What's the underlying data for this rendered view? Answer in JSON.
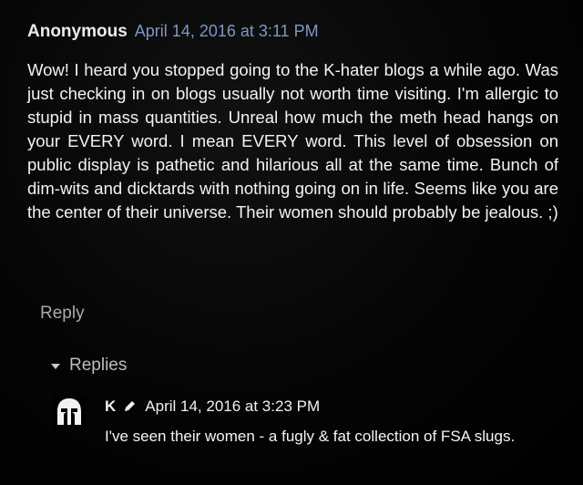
{
  "comment": {
    "author": "Anonymous",
    "timestamp": "April 14, 2016 at 3:11 PM",
    "text": "Wow! I heard you stopped going to the K-hater blogs a while ago. Was just checking in on blogs usually not worth time visiting. I'm allergic to stupid in mass quantities. Unreal how much the meth head hangs on your EVERY word. I mean EVERY word. This level of obsession on public display is pathetic and hilarious all at the same time. Bunch of dim-wits and dicktards with nothing going on in life. Seems like you are the center of their universe. Their women should probably be jealous. ;)",
    "reply_label": "Reply"
  },
  "replies": {
    "toggle_label": "Replies",
    "items": [
      {
        "author": "K",
        "timestamp": "April 14, 2016 at 3:23 PM",
        "text": "I've seen their women - a fugly & fat collection of FSA slugs.",
        "avatar_icon": "spartan-helmet-icon",
        "edit_icon": "pencil-icon"
      }
    ]
  },
  "colors": {
    "background": "#000000",
    "timestamp_link": "#7f96c6",
    "muted_text": "#a9a9a9"
  }
}
